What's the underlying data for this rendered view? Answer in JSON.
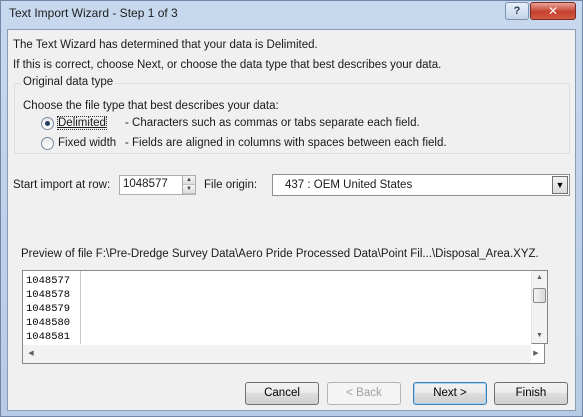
{
  "window": {
    "title": "Text Import Wizard - Step 1 of 3",
    "help_label": "?",
    "close_label": "✕"
  },
  "intro": {
    "line1": "The Text Wizard has determined that your data is Delimited.",
    "line2": "If this is correct, choose Next, or choose the data type that best describes your data."
  },
  "original_type": {
    "legend": "Original data type",
    "prompt": "Choose the file type that best describes your data:",
    "options": [
      {
        "label": "Delimited",
        "description": "- Characters such as commas or tabs separate each field.",
        "selected": true
      },
      {
        "label": "Fixed width",
        "description": "- Fields are aligned in columns with spaces between each field.",
        "selected": false
      }
    ]
  },
  "start_row": {
    "label": "Start import at row:",
    "value": "1048577"
  },
  "file_origin": {
    "label": "File origin:",
    "value": "437 : OEM United States"
  },
  "preview": {
    "label": "Preview of file F:\\Pre-Dredge Survey Data\\Aero Pride Processed Data\\Point Fil...\\Disposal_Area.XYZ.",
    "rows": [
      "1048577",
      "1048578",
      "1048579",
      "1048580",
      "1048581"
    ]
  },
  "buttons": {
    "cancel": "Cancel",
    "back": "< Back",
    "next": "Next >",
    "finish": "Finish"
  }
}
